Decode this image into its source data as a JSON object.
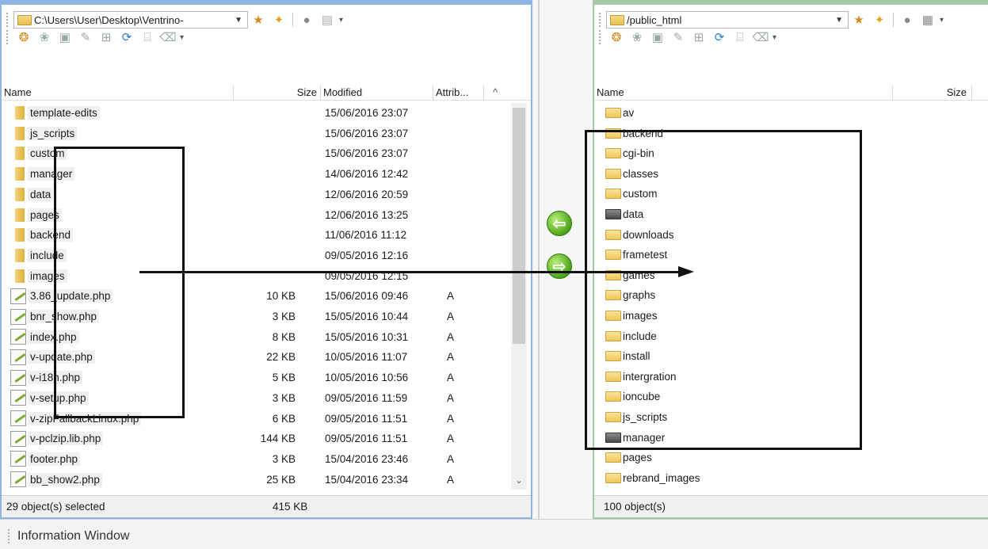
{
  "left": {
    "path": "C:\\Users\\User\\Desktop\\Ventrino-",
    "columns": {
      "name": "Name",
      "size": "Size",
      "modified": "Modified",
      "attrib": "Attrib..."
    },
    "rows": [
      {
        "name": "template-edits",
        "type": "folder",
        "size": "",
        "modified": "15/06/2016 23:07",
        "attrib": ""
      },
      {
        "name": "js_scripts",
        "type": "folder",
        "size": "",
        "modified": "15/06/2016 23:07",
        "attrib": ""
      },
      {
        "name": "custom",
        "type": "folder",
        "size": "",
        "modified": "15/06/2016 23:07",
        "attrib": ""
      },
      {
        "name": "manager",
        "type": "folder",
        "size": "",
        "modified": "14/06/2016 12:42",
        "attrib": ""
      },
      {
        "name": "data",
        "type": "folder",
        "size": "",
        "modified": "12/06/2016 20:59",
        "attrib": ""
      },
      {
        "name": "pages",
        "type": "folder",
        "size": "",
        "modified": "12/06/2016 13:25",
        "attrib": ""
      },
      {
        "name": "backend",
        "type": "folder",
        "size": "",
        "modified": "11/06/2016 11:12",
        "attrib": ""
      },
      {
        "name": "include",
        "type": "folder",
        "size": "",
        "modified": "09/05/2016 12:16",
        "attrib": ""
      },
      {
        "name": "images",
        "type": "folder",
        "size": "",
        "modified": "09/05/2016 12:15",
        "attrib": ""
      },
      {
        "name": "3.86_update.php",
        "type": "file",
        "size": "10 KB",
        "modified": "15/06/2016 09:46",
        "attrib": "A"
      },
      {
        "name": "bnr_show.php",
        "type": "file",
        "size": "3 KB",
        "modified": "15/05/2016 10:44",
        "attrib": "A"
      },
      {
        "name": "index.php",
        "type": "file",
        "size": "8 KB",
        "modified": "15/05/2016 10:31",
        "attrib": "A"
      },
      {
        "name": "v-update.php",
        "type": "file",
        "size": "22 KB",
        "modified": "10/05/2016 11:07",
        "attrib": "A"
      },
      {
        "name": "v-i18n.php",
        "type": "file",
        "size": "5 KB",
        "modified": "10/05/2016 10:56",
        "attrib": "A"
      },
      {
        "name": "v-setup.php",
        "type": "file",
        "size": "3 KB",
        "modified": "09/05/2016 11:59",
        "attrib": "A"
      },
      {
        "name": "v-zipFallbackLinux.php",
        "type": "file",
        "size": "6 KB",
        "modified": "09/05/2016 11:51",
        "attrib": "A"
      },
      {
        "name": "v-pclzip.lib.php",
        "type": "file",
        "size": "144 KB",
        "modified": "09/05/2016 11:51",
        "attrib": "A"
      },
      {
        "name": "footer.php",
        "type": "file",
        "size": "3 KB",
        "modified": "15/04/2016 23:46",
        "attrib": "A"
      },
      {
        "name": "bb_show2.php",
        "type": "file",
        "size": "25 KB",
        "modified": "15/04/2016 23:34",
        "attrib": "A"
      }
    ],
    "status_selected": "29 object(s) selected",
    "status_size": "415 KB"
  },
  "right": {
    "path": "/public_html",
    "columns": {
      "name": "Name",
      "size": "Size"
    },
    "rows": [
      {
        "name": "av",
        "dark": false
      },
      {
        "name": "backend",
        "dark": false
      },
      {
        "name": "cgi-bin",
        "dark": false
      },
      {
        "name": "classes",
        "dark": false
      },
      {
        "name": "custom",
        "dark": false
      },
      {
        "name": "data",
        "dark": true
      },
      {
        "name": "downloads",
        "dark": false
      },
      {
        "name": "frametest",
        "dark": false
      },
      {
        "name": "games",
        "dark": false
      },
      {
        "name": "graphs",
        "dark": false
      },
      {
        "name": "images",
        "dark": false
      },
      {
        "name": "include",
        "dark": false
      },
      {
        "name": "install",
        "dark": false
      },
      {
        "name": "intergration",
        "dark": false
      },
      {
        "name": "ioncube",
        "dark": false
      },
      {
        "name": "js_scripts",
        "dark": false
      },
      {
        "name": "manager",
        "dark": true
      },
      {
        "name": "pages",
        "dark": false
      },
      {
        "name": "rebrand_images",
        "dark": false
      }
    ],
    "status": "100 object(s)"
  },
  "transfer": {
    "download_icon": "arrow-left-icon",
    "upload_icon": "arrow-right-icon"
  },
  "info_window": {
    "label": "Information Window"
  },
  "colors": {
    "left_accent": "#8fb4e3",
    "right_accent": "#a4c9a4",
    "transfer_green": "#4da318"
  }
}
